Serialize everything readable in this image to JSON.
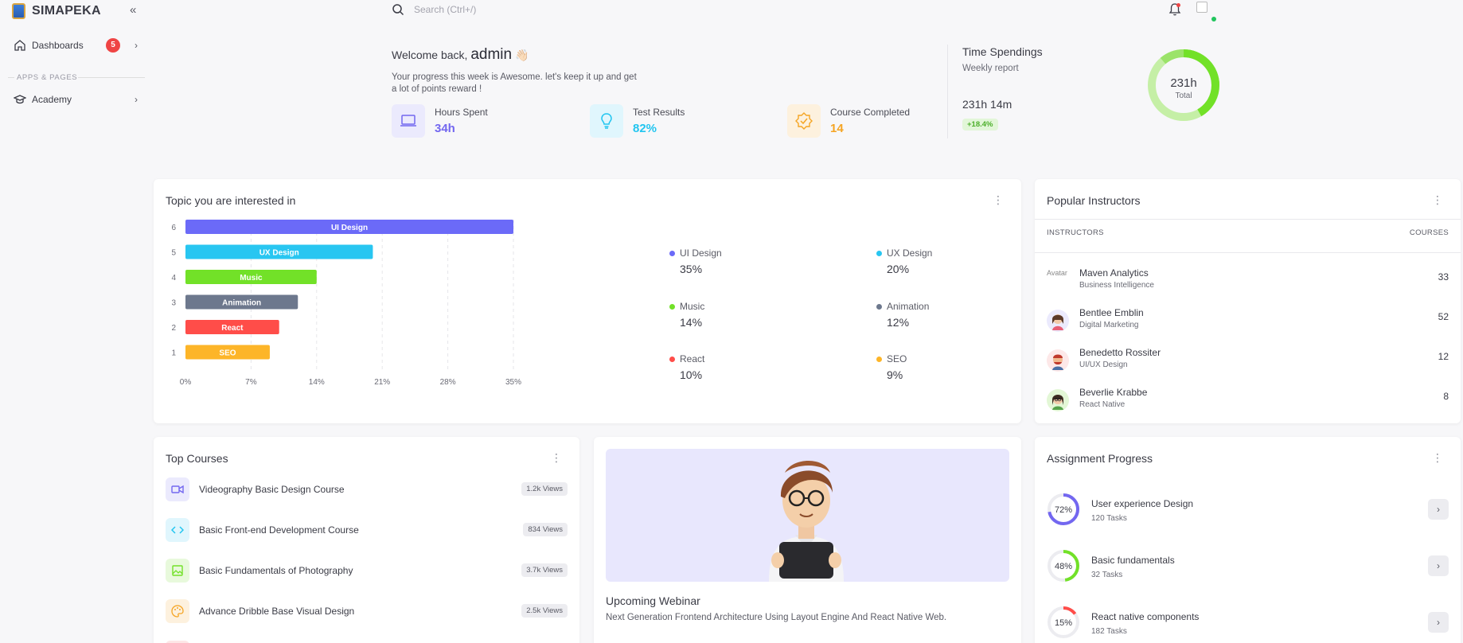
{
  "sidebar": {
    "brand": "SIMAPEKA",
    "items": [
      {
        "label": "Dashboards",
        "badge": "5"
      },
      {
        "label": "Academy"
      }
    ],
    "section_label": "APPS & PAGES"
  },
  "topbar": {
    "search_placeholder": "Search (Ctrl+/)"
  },
  "welcome": {
    "prefix": "Welcome back,",
    "name": "admin",
    "emoji": "👋🏻",
    "subtitle": "Your progress this week is Awesome. let's keep it up and get a lot of points reward !"
  },
  "stats": [
    {
      "label": "Hours Spent",
      "value": "34h",
      "color": "#7367f0"
    },
    {
      "label": "Test Results",
      "value": "82%",
      "color": "#22c5f0"
    },
    {
      "label": "Course Completed",
      "value": "14",
      "color": "#f5a524"
    }
  ],
  "time_spendings": {
    "title": "Time Spendings",
    "subtitle": "Weekly report",
    "value": "231h 14m",
    "change": "+18.4%",
    "donut_value": "231h",
    "donut_label": "Total"
  },
  "topics": {
    "title": "Topic you are interested in",
    "legend": [
      {
        "name": "UI Design",
        "pct": "35%",
        "color": "#6b6af8"
      },
      {
        "name": "UX Design",
        "pct": "20%",
        "color": "#28c6f1"
      },
      {
        "name": "Music",
        "pct": "14%",
        "color": "#72e128"
      },
      {
        "name": "Animation",
        "pct": "12%",
        "color": "#6d788d"
      },
      {
        "name": "React",
        "pct": "10%",
        "color": "#ff4d49"
      },
      {
        "name": "SEO",
        "pct": "9%",
        "color": "#fdb528"
      }
    ]
  },
  "chart_data": {
    "type": "bar",
    "orientation": "horizontal",
    "categories": [
      "UI Design",
      "UX Design",
      "Music",
      "Animation",
      "React",
      "SEO"
    ],
    "y_tick_labels": [
      "6",
      "5",
      "4",
      "3",
      "2",
      "1"
    ],
    "values": [
      35,
      20,
      14,
      12,
      10,
      9
    ],
    "x_ticks": [
      "0%",
      "7%",
      "14%",
      "21%",
      "28%",
      "35%"
    ],
    "xlim": [
      0,
      35
    ],
    "colors": [
      "#6b6af8",
      "#28c6f1",
      "#72e128",
      "#6d788d",
      "#ff4d49",
      "#fdb528"
    ],
    "grid": true
  },
  "instructors": {
    "title": "Popular Instructors",
    "col_instructors": "INSTRUCTORS",
    "col_courses": "COURSES",
    "rows": [
      {
        "name": "Maven Analytics",
        "role": "Business Intelligence",
        "courses": "33",
        "avatar_alt": "Avatar"
      },
      {
        "name": "Bentlee Emblin",
        "role": "Digital Marketing",
        "courses": "52"
      },
      {
        "name": "Benedetto Rossiter",
        "role": "UI/UX Design",
        "courses": "12"
      },
      {
        "name": "Beverlie Krabbe",
        "role": "React Native",
        "courses": "8"
      }
    ]
  },
  "top_courses": {
    "title": "Top Courses",
    "rows": [
      {
        "name": "Videography Basic Design Course",
        "views": "1.2k Views",
        "icon": "video-icon",
        "color": "#7367f0",
        "bg": "#ebeafd"
      },
      {
        "name": "Basic Front-end Development Course",
        "views": "834 Views",
        "icon": "code-icon",
        "color": "#22c5f0",
        "bg": "#e0f6fd"
      },
      {
        "name": "Basic Fundamentals of Photography",
        "views": "3.7k Views",
        "icon": "image-icon",
        "color": "#72e128",
        "bg": "#e8f9dc"
      },
      {
        "name": "Advance Dribble Base Visual Design",
        "views": "2.5k Views",
        "icon": "palette-icon",
        "color": "#f5a524",
        "bg": "#fdf1de"
      }
    ]
  },
  "webinar": {
    "title": "Upcoming Webinar",
    "subtitle": "Next Generation Frontend Architecture Using Layout Engine And React Native Web."
  },
  "assignments": {
    "title": "Assignment Progress",
    "rows": [
      {
        "title": "User experience Design",
        "tasks": "120 Tasks",
        "pct": "72%",
        "value": 72,
        "color": "#7367f0"
      },
      {
        "title": "Basic fundamentals",
        "tasks": "32 Tasks",
        "pct": "48%",
        "value": 48,
        "color": "#72e128"
      },
      {
        "title": "React native components",
        "tasks": "182 Tasks",
        "pct": "15%",
        "value": 15,
        "color": "#ff4d49"
      }
    ]
  }
}
